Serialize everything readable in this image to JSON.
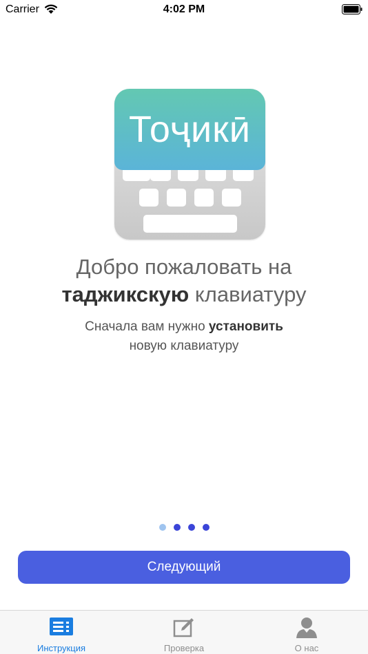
{
  "status_bar": {
    "carrier": "Carrier",
    "time": "4:02 PM"
  },
  "logo": {
    "text": "Тоҷикӣ"
  },
  "welcome": {
    "line1": "Добро пожаловать на",
    "line2_bold": "таджикскую",
    "line2_rest": "клавиатуру"
  },
  "subtitle": {
    "line1_start": "Сначала вам нужно",
    "line1_bold": "установить",
    "line2": "новую клавиатуру"
  },
  "pagination": {
    "current_page": 1,
    "total_pages": 4,
    "active_color": "#9fc4ef",
    "inactive_color": "#3b45d8"
  },
  "next_button": {
    "label": "Следующий",
    "color": "#4a5fe0"
  },
  "tab_bar": {
    "tabs": [
      {
        "label": "Инструкция",
        "icon": "list-icon",
        "active": true
      },
      {
        "label": "Проверка",
        "icon": "compose-icon",
        "active": false
      },
      {
        "label": "О нас",
        "icon": "person-icon",
        "active": false
      }
    ],
    "active_color": "#1a7de0",
    "inactive_color": "#8e8e8e"
  }
}
